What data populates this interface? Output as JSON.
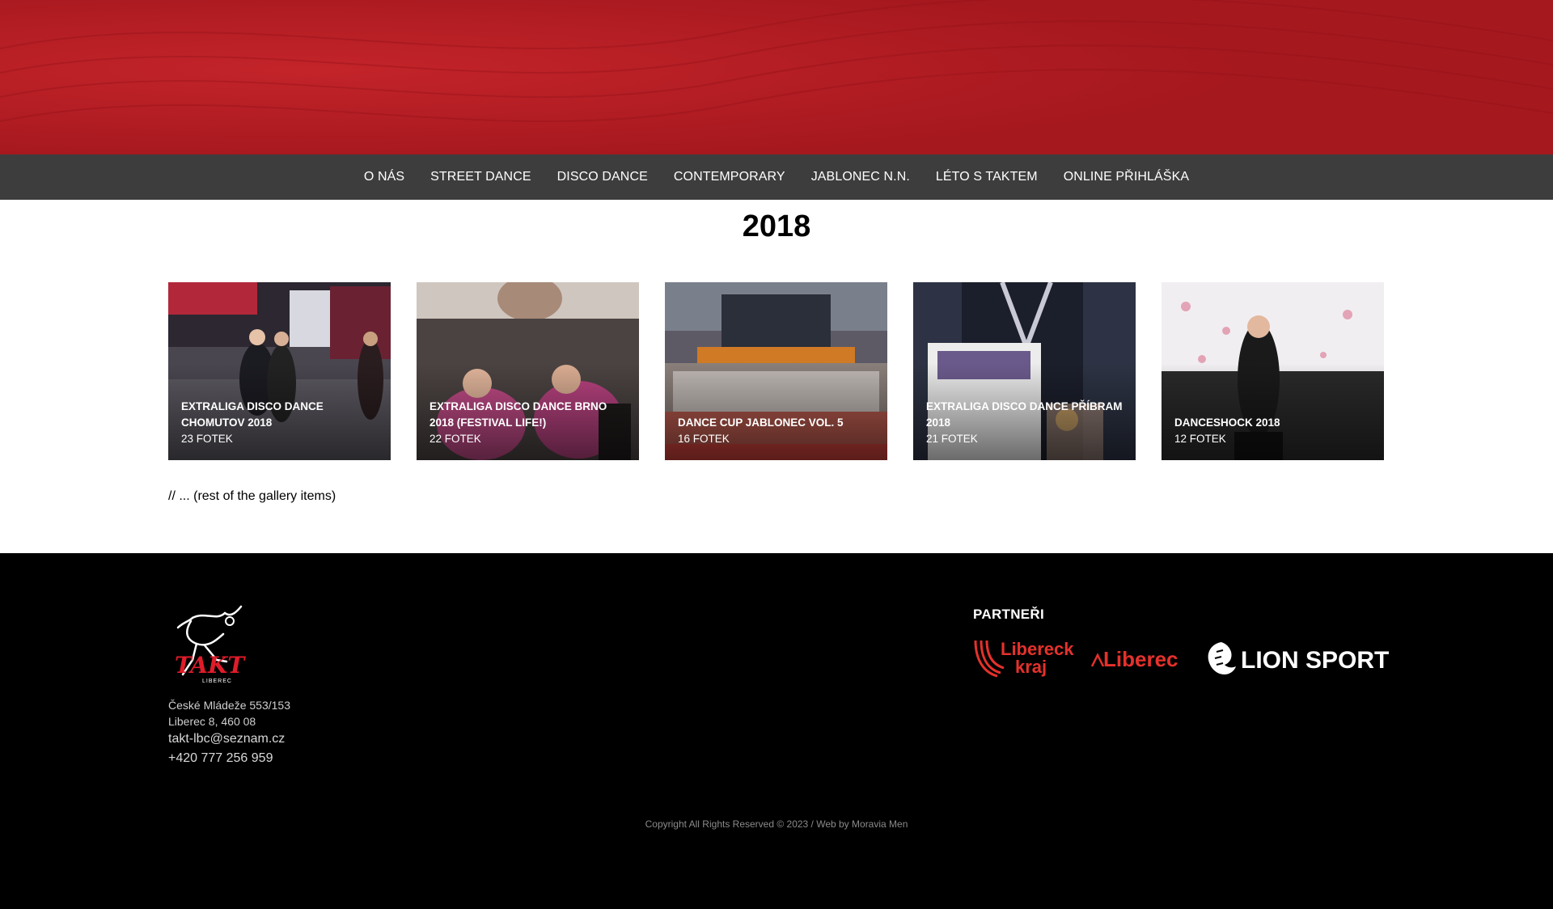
{
  "nav": {
    "items": [
      {
        "label": "O NÁS"
      },
      {
        "label": "STREET DANCE"
      },
      {
        "label": "DISCO DANCE"
      },
      {
        "label": "CONTEMPORARY"
      },
      {
        "label": "JABLONEC N.N."
      },
      {
        "label": "LÉTO S TAKTEM"
      },
      {
        "label": "ONLINE PŘIHLÁŠKA"
      }
    ]
  },
  "page": {
    "title": "2018"
  },
  "gallery": {
    "items": [
      {
        "title": "EXTRALIGA DISCO DANCE CHOMUTOV 2018",
        "count": "23 FOTEK"
      },
      {
        "title": "EXTRALIGA DISCO DANCE BRNO 2018 (FESTIVAL LIFE!)",
        "count": "22 FOTEK"
      },
      {
        "title": "DANCE CUP JABLONEC VOL. 5",
        "count": "16 FOTEK"
      },
      {
        "title": "EXTRALIGA DISCO DANCE PŘÍBRAM 2018",
        "count": "21 FOTEK"
      },
      {
        "title": "DANCESHOCK 2018",
        "count": "12 FOTEK"
      }
    ],
    "rest_note": "// ... (rest of the gallery items)"
  },
  "footer": {
    "logo_text": "TAKT LIBEREC",
    "address_line1": "České Mládeže 553/153",
    "address_line2": "Liberec 8, 460 08",
    "email": "takt-lbc@seznam.cz",
    "phone": "+420 777 256 959",
    "partners_heading": "PARTNEŘI",
    "partners": [
      {
        "name": "Liberecký kraj",
        "color": "#e5312c"
      },
      {
        "name": "Liberec",
        "color": "#e5312c"
      },
      {
        "name": "LION SPORT",
        "color": "#ffffff"
      }
    ],
    "copyright": "Copyright All Rights Reserved © 2023 / Web by Moravia Men"
  },
  "colors": {
    "hero": "#a91a20",
    "nav_bg": "#3d3d3d",
    "footer_bg": "#000000"
  }
}
